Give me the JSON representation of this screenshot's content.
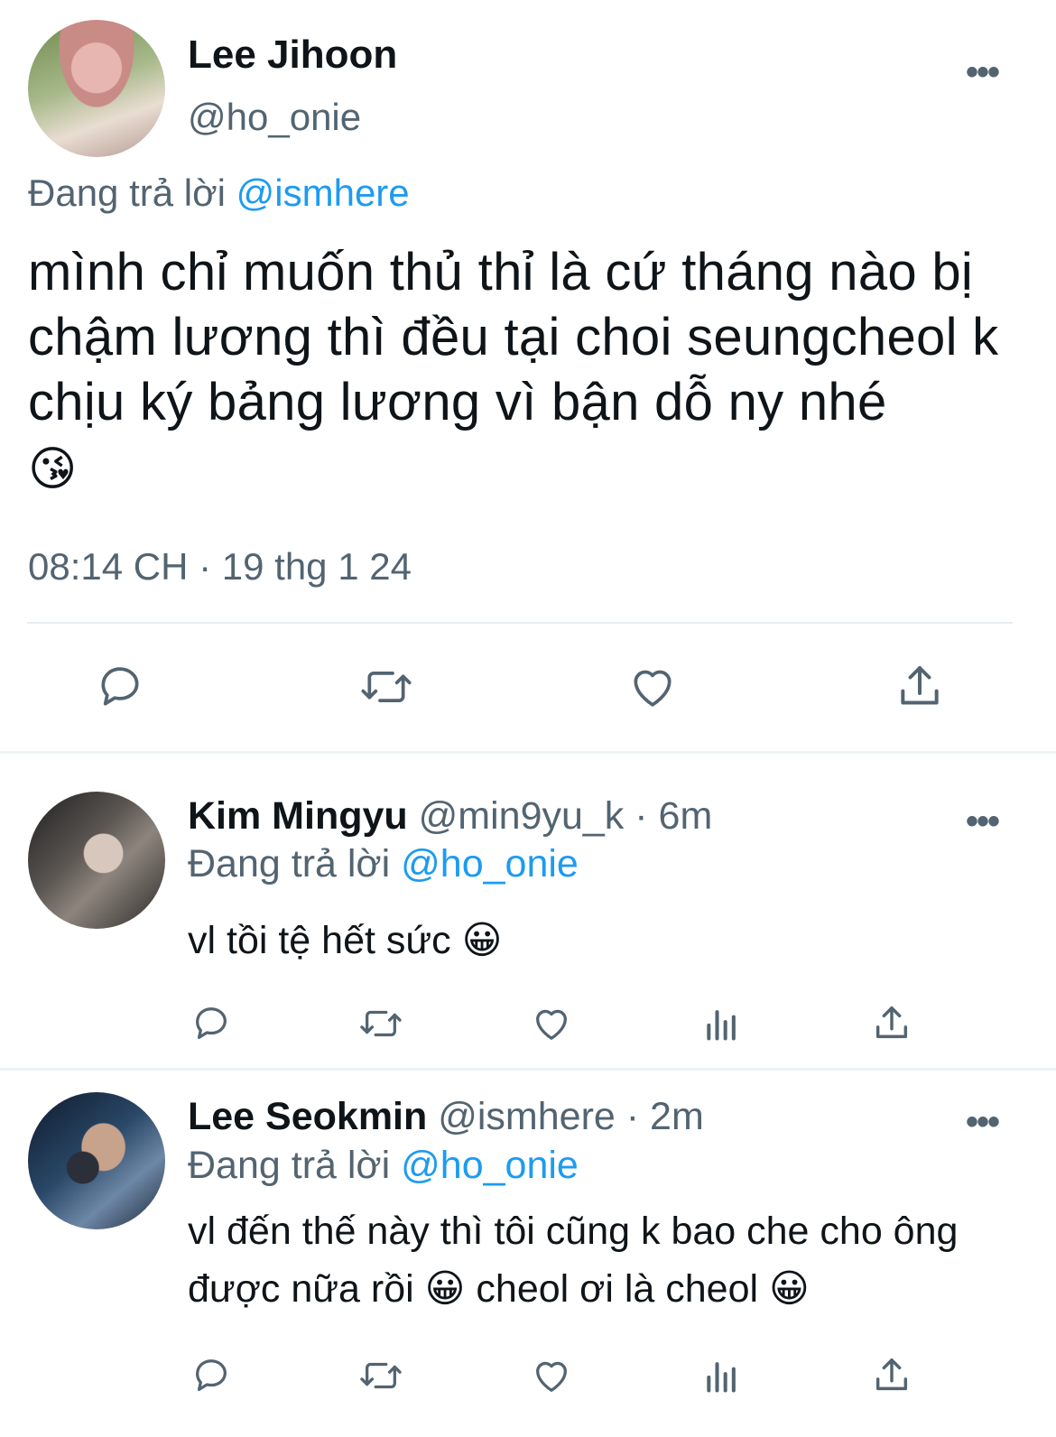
{
  "main_tweet": {
    "display_name": "Lee Jihoon",
    "handle": "@ho_onie",
    "more_icon": "•••",
    "reply_prefix": "Đang trả lời",
    "reply_to": "@ismhere",
    "text": "mình chỉ muốn thủ thỉ là cứ tháng nào bị chậm lương thì đều tại choi seungcheol k chịu ký bảng lương vì bận dỗ ny nhé",
    "emoji": "😘",
    "timestamp": "08:14 CH · 19 thg 1 24",
    "actions": [
      "reply-icon",
      "retweet-icon",
      "like-icon",
      "share-icon"
    ]
  },
  "replies": [
    {
      "display_name": "Kim Mingyu",
      "handle": "@min9yu_k",
      "time": "· 6m",
      "more_icon": "•••",
      "reply_prefix": "Đang trả lời",
      "reply_to": "@ho_onie",
      "text": "vl tồi tệ hết sức 😀",
      "actions": [
        "reply-icon",
        "retweet-icon",
        "like-icon",
        "views-icon",
        "share-icon"
      ]
    },
    {
      "display_name": "Lee Seokmin",
      "handle": "@ismhere",
      "time": "· 2m",
      "more_icon": "•••",
      "reply_prefix": "Đang trả lời",
      "reply_to": "@ho_onie",
      "text": "vl đến thế này thì tôi cũng k bao che cho ông được nữa rồi 😀  cheol ơi là cheol 😀",
      "actions": [
        "reply-icon",
        "retweet-icon",
        "like-icon",
        "views-icon",
        "share-icon"
      ]
    }
  ],
  "colors": {
    "text": "#0f1419",
    "muted": "#536471",
    "link": "#1d9bf0",
    "divider": "#eff3f4"
  }
}
